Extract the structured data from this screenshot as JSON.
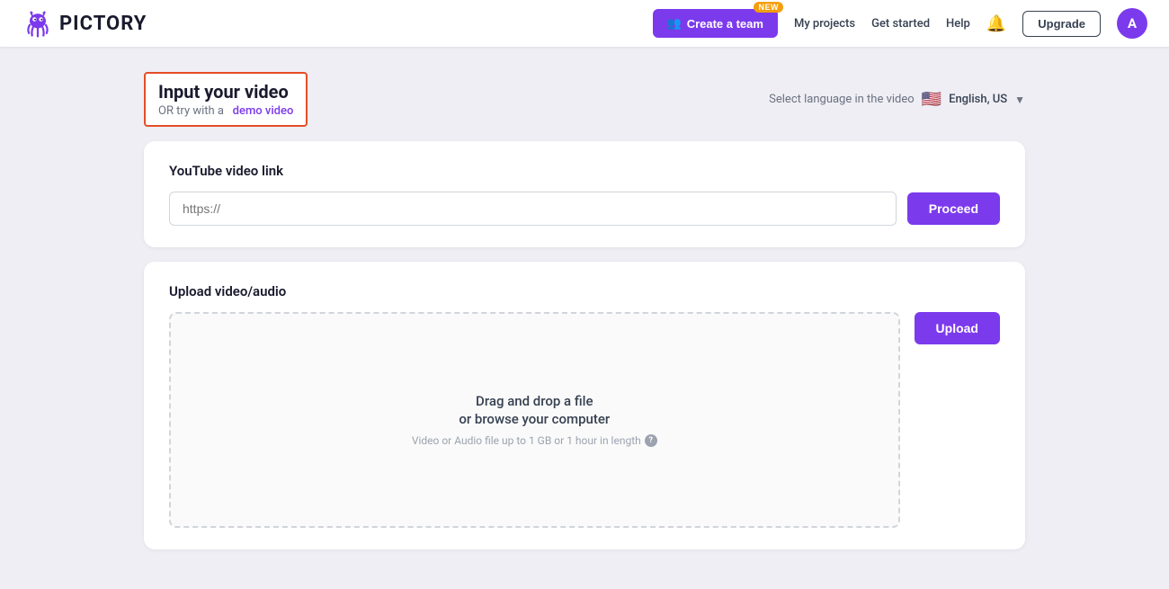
{
  "header": {
    "logo_text": "PICTORY",
    "create_team_label": "Create a team",
    "new_badge": "NEW",
    "nav_links": [
      "My projects",
      "Get started",
      "Help"
    ],
    "bell_label": "🔔",
    "upgrade_label": "Upgrade",
    "avatar_label": "A"
  },
  "page": {
    "input_video_title": "Input your video",
    "try_with": "OR try with a",
    "demo_link": "demo video",
    "language_label": "Select language in the video",
    "flag": "🇺🇸",
    "language_value": "English, US"
  },
  "youtube_card": {
    "title": "YouTube video link",
    "placeholder": "https://",
    "proceed_label": "Proceed"
  },
  "upload_card": {
    "title": "Upload video/audio",
    "drag_drop": "Drag and drop a file",
    "browse": "or browse your computer",
    "hint": "Video or Audio file up to 1 GB or 1 hour in length",
    "upload_label": "Upload"
  }
}
